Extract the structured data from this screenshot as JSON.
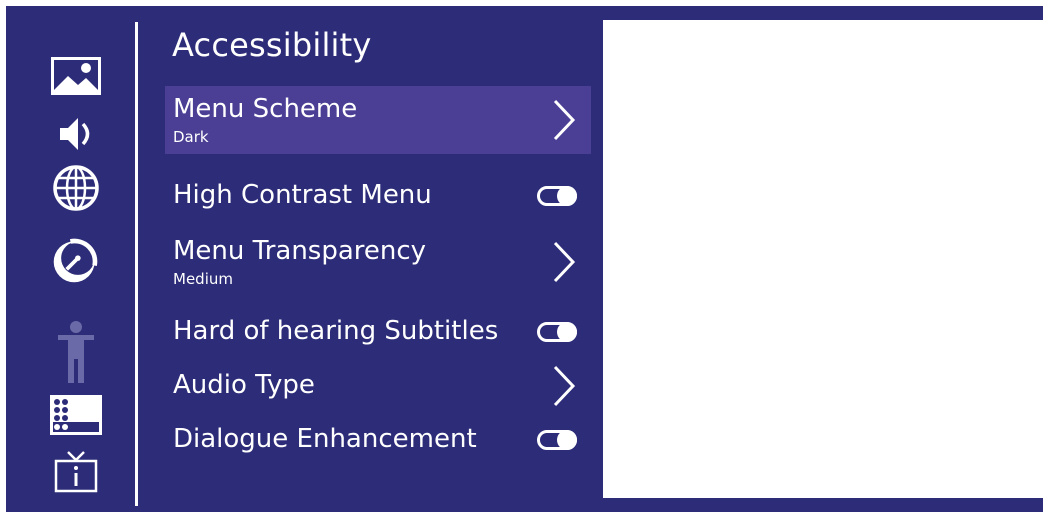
{
  "colors": {
    "background": "#2c2c78",
    "selected_row": "#4a3f95",
    "text": "#ffffff",
    "preview": "#ffffff"
  },
  "sidebar": {
    "icons": [
      "picture-icon",
      "sound-icon",
      "network-icon",
      "satellite-icon",
      "accessibility-icon",
      "channel-list-icon",
      "tv-info-icon"
    ],
    "active": "accessibility-icon"
  },
  "header": {
    "title": "Accessibility"
  },
  "menu": {
    "items": [
      {
        "label": "Menu Scheme",
        "value": "Dark",
        "control": "chevron",
        "selected": true
      },
      {
        "label": "High Contrast Menu",
        "value": "",
        "control": "toggle"
      },
      {
        "label": "Menu Transparency",
        "value": "Medium",
        "control": "chevron"
      },
      {
        "label": "Hard of hearing Subtitles",
        "value": "",
        "control": "toggle"
      },
      {
        "label": "Audio Type",
        "value": "",
        "control": "chevron"
      },
      {
        "label": "Dialogue Enhancement",
        "value": "",
        "control": "toggle"
      }
    ]
  }
}
